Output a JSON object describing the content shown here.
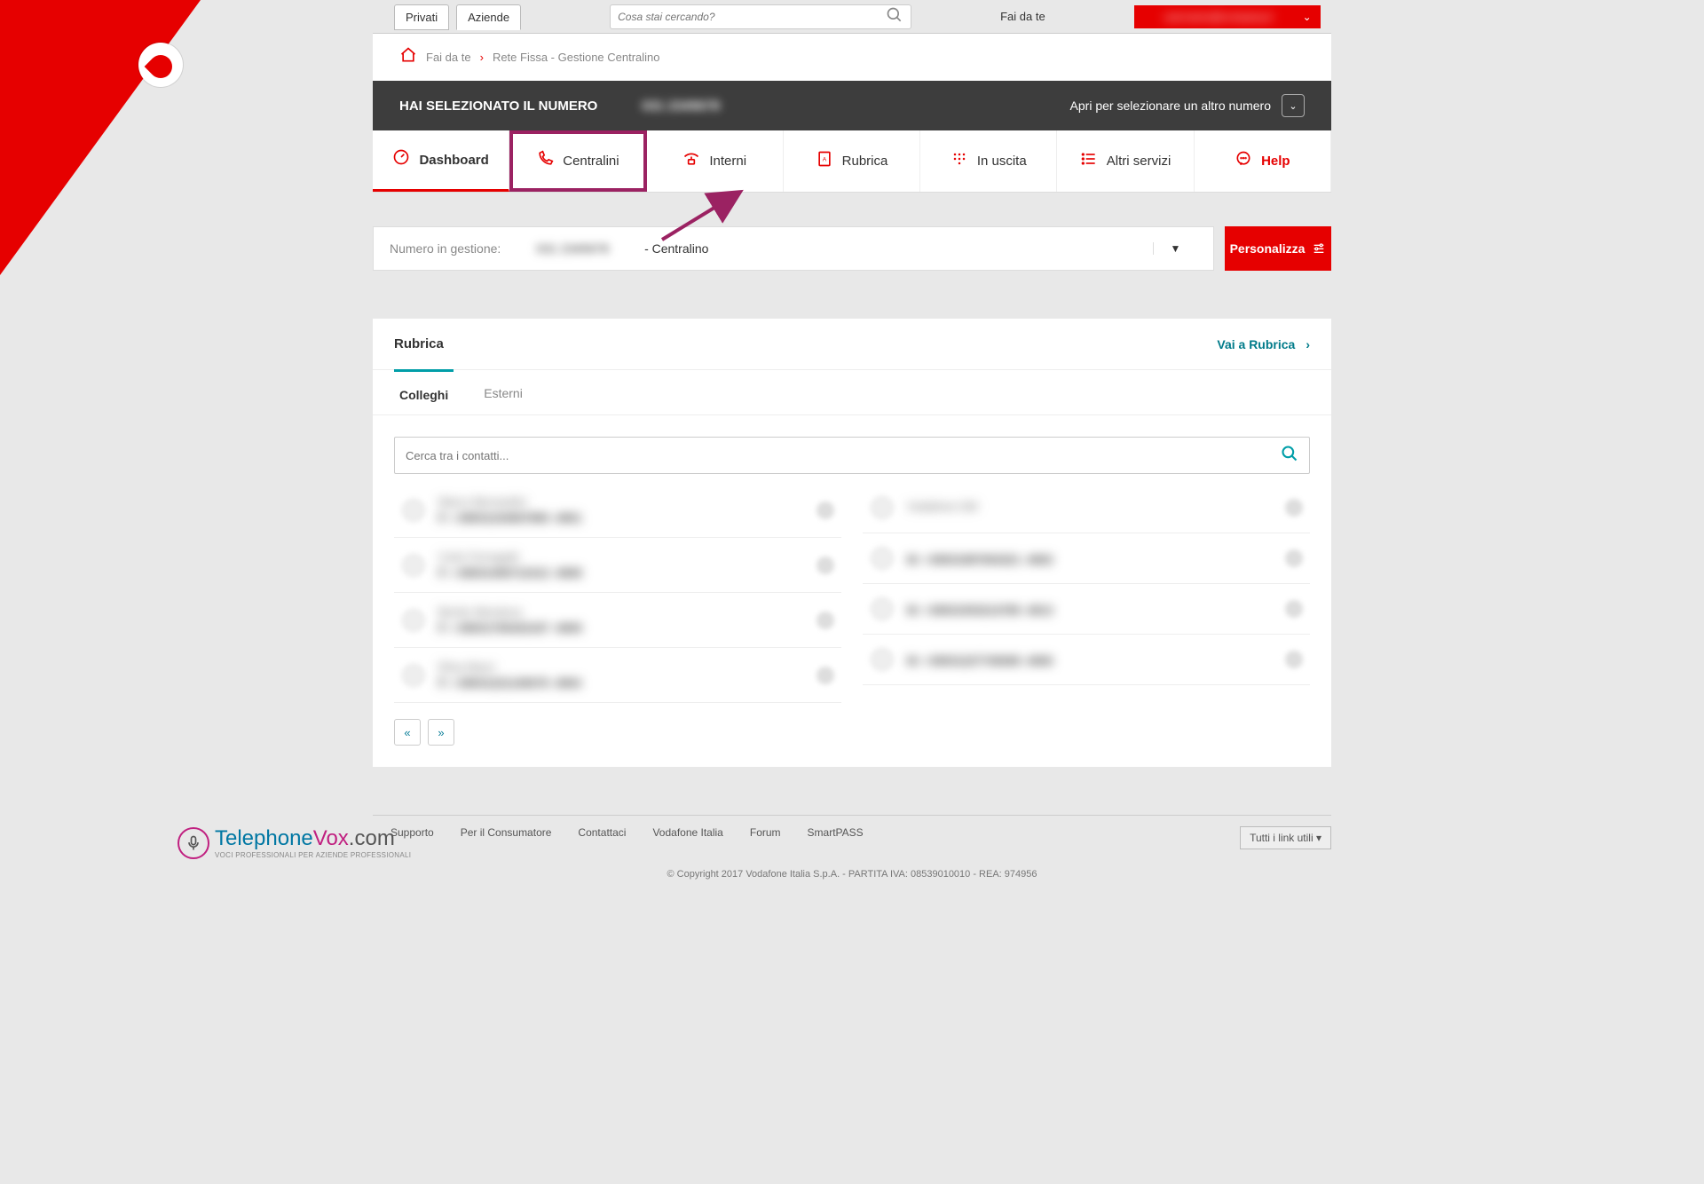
{
  "topbar": {
    "tab_privati": "Privati",
    "tab_aziende": "Aziende",
    "search_placeholder": "Cosa stai cercando?",
    "faidate_label": "Fai da te"
  },
  "breadcrumb": {
    "b1": "Fai da te",
    "b2": "Rete Fissa - Gestione Centralino"
  },
  "darkbar": {
    "title": "HAI SELEZIONATO IL NUMERO",
    "right": "Apri per selezionare un altro numero"
  },
  "nav": {
    "dashboard": "Dashboard",
    "centralini": "Centralini",
    "interni": "Interni",
    "rubrica": "Rubrica",
    "inuscita": "In uscita",
    "altri": "Altri servizi",
    "help": "Help"
  },
  "numbar": {
    "label": "Numero in gestione:",
    "suffix": " - Centralino",
    "btn": "Personalizza"
  },
  "panel": {
    "title": "Rubrica",
    "link": "Vai a Rubrica",
    "tab_colleghi": "Colleghi",
    "tab_esterni": "Esterni",
    "search_placeholder": "Cerca tra i contatti..."
  },
  "contacts_left": [
    {
      "name": "Marco Bernardini",
      "num": "F: +39031234567890 -4901"
    },
    {
      "name": "Carlo Ferragatti",
      "num": "F: +39031456712312 -4908"
    },
    {
      "name": "Benito Mendoza",
      "num": "F: +39031765432187 -4909"
    },
    {
      "name": "Elisa Marzi",
      "num": "F: +39031221145678 -4904"
    }
  ],
  "contacts_right": [
    {
      "name": "Vodafone GM",
      "num": ""
    },
    {
      "name": "",
      "num": "M: +39031987654321 -4902"
    },
    {
      "name": "",
      "num": "M: +39031553214789 -4913"
    },
    {
      "name": "",
      "num": "M: +39031227745698 -4906"
    }
  ],
  "footer": {
    "supporto": "Supporto",
    "consumatore": "Per il Consumatore",
    "contattaci": "Contattaci",
    "vodafone_italia": "Vodafone Italia",
    "forum": "Forum",
    "smartpass": "SmartPASS",
    "all_links": "Tutti i link utili ▾"
  },
  "copyright": "© Copyright 2017 Vodafone Italia S.p.A. - PARTITA IVA: 08539010010 - REA: 974956",
  "tv": {
    "t1": "Telephone",
    "t2": "Vox",
    "t3": ".com",
    "sub": "VOCI PROFESSIONALI PER AZIENDE PROFESSIONALI"
  }
}
